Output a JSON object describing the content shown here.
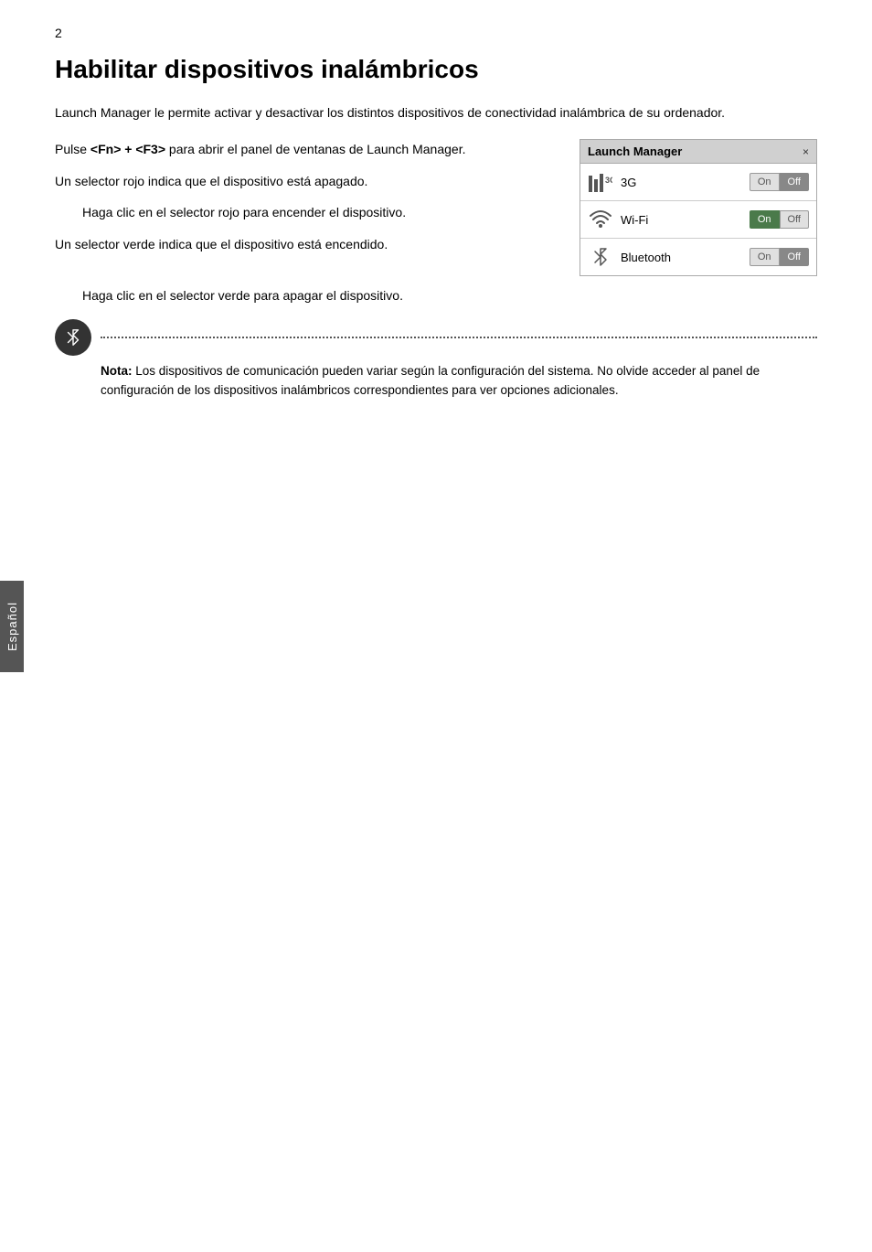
{
  "page": {
    "number": "2",
    "sidebar_label": "Español"
  },
  "heading": "Habilitar dispositivos inalámbricos",
  "intro": "Launch Manager le permite activar y desactivar los distintos dispositivos de conectividad inalámbrica de su ordenador.",
  "paragraphs": {
    "p1": "Pulse ",
    "p1_keys": "<Fn> + <F3>",
    "p1_rest": " para abrir el panel de ventanas de Launch Manager.",
    "p2": "Un selector rojo indica que el dispositivo está apagado.",
    "p3_indent": "Haga clic en el selector rojo para encender el dispositivo.",
    "p4": "Un selector verde indica que el dispositivo está encendido.",
    "p5_indent": "Haga clic en el selector verde para apagar el dispositivo."
  },
  "launch_manager": {
    "title": "Launch Manager",
    "close": "×",
    "devices": [
      {
        "icon": "3G",
        "name": "3G",
        "on_label": "On",
        "off_label": "Off",
        "on_active": false,
        "off_active": true
      },
      {
        "icon": "wifi",
        "name": "Wi-Fi",
        "on_label": "On",
        "off_label": "Off",
        "on_active": true,
        "off_active": false
      },
      {
        "icon": "bt",
        "name": "Bluetooth",
        "on_label": "On",
        "off_label": "Off",
        "on_active": false,
        "off_active": true
      }
    ]
  },
  "note": {
    "bold_prefix": "Nota:",
    "text": " Los dispositivos de comunicación pueden variar según la configuración del sistema. No olvide acceder al panel de configuración de los dispositivos inalámbricos correspondientes para ver opciones adicionales."
  }
}
